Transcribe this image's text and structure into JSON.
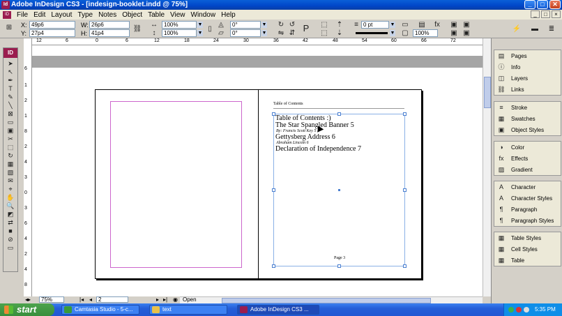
{
  "window": {
    "title": "Adobe InDesign CS3 - [indesign-booklet.indd @ 75%]",
    "app_icon": "Id",
    "buttons": [
      "_",
      "□",
      "✕"
    ]
  },
  "menu": {
    "logo": "ID",
    "items": [
      "File",
      "Edit",
      "Layout",
      "Type",
      "Notes",
      "Object",
      "Table",
      "View",
      "Window",
      "Help"
    ]
  },
  "control": {
    "x_label": "X:",
    "x_value": "49p6",
    "y_label": "Y:",
    "y_value": "27p4",
    "w_label": "W:",
    "w_value": "26p6",
    "h_label": "H:",
    "h_value": "41p4",
    "scale_x": "100%",
    "scale_y": "100%",
    "rotate": "0°",
    "shear": "0°",
    "stroke_weight": "0 pt",
    "opacity": "100%"
  },
  "rulers": {
    "h_ticks": [
      "12",
      "6",
      "0",
      "6",
      "12",
      "18",
      "24",
      "30",
      "36",
      "42",
      "48",
      "54",
      "60",
      "66",
      "72"
    ],
    "v_ticks": [
      "6",
      "1",
      "2",
      "1",
      "8",
      "2",
      "4",
      "3",
      "0",
      "3",
      "6",
      "4",
      "2",
      "4",
      "8"
    ]
  },
  "document": {
    "header_text": "Table of Contents",
    "toc_lines": [
      {
        "text": "Table of Contents :)",
        "kind": "title"
      },
      {
        "text": "The Star Spangled Banner    5",
        "kind": "entry"
      },
      {
        "text": "By: Francis Scott Key        5",
        "kind": "author"
      },
      {
        "text": "Gettysberg Address     6",
        "kind": "entry"
      },
      {
        "text": "Abraham Lincoln     6",
        "kind": "author"
      },
      {
        "text": "Declaration of Independence      7",
        "kind": "entry"
      }
    ],
    "page_footer": "Page 3"
  },
  "status": {
    "zoom": "75%",
    "page": "2",
    "preflight": "Open"
  },
  "panels": {
    "groups": [
      [
        {
          "label": "Pages",
          "icon": "pages-icon"
        },
        {
          "label": "Info",
          "icon": "info-icon"
        },
        {
          "label": "Layers",
          "icon": "layers-icon"
        },
        {
          "label": "Links",
          "icon": "links-icon"
        }
      ],
      [
        {
          "label": "Stroke",
          "icon": "stroke-icon"
        },
        {
          "label": "Swatches",
          "icon": "swatches-icon"
        },
        {
          "label": "Object Styles",
          "icon": "object-styles-icon"
        }
      ],
      [
        {
          "label": "Color",
          "icon": "color-icon"
        },
        {
          "label": "Effects",
          "icon": "effects-icon"
        },
        {
          "label": "Gradient",
          "icon": "gradient-icon"
        }
      ],
      [
        {
          "label": "Character",
          "icon": "character-icon"
        },
        {
          "label": "Character Styles",
          "icon": "character-styles-icon"
        },
        {
          "label": "Paragraph",
          "icon": "paragraph-icon"
        },
        {
          "label": "Paragraph Styles",
          "icon": "paragraph-styles-icon"
        }
      ],
      [
        {
          "label": "Table Styles",
          "icon": "table-styles-icon"
        },
        {
          "label": "Cell Styles",
          "icon": "cell-styles-icon"
        },
        {
          "label": "Table",
          "icon": "table-icon"
        }
      ]
    ]
  },
  "taskbar": {
    "start": "start",
    "tasks": [
      {
        "label": "Camtasia Studio - 5-c...",
        "icon": "camtasia-icon",
        "color": "#3a9a3a"
      },
      {
        "label": "text",
        "icon": "folder-icon",
        "color": "#e8c04a"
      },
      {
        "label": "Adobe InDesign CS3 ...",
        "icon": "indesign-icon",
        "color": "#9b1d4f"
      }
    ],
    "clock": "5:35 PM"
  }
}
